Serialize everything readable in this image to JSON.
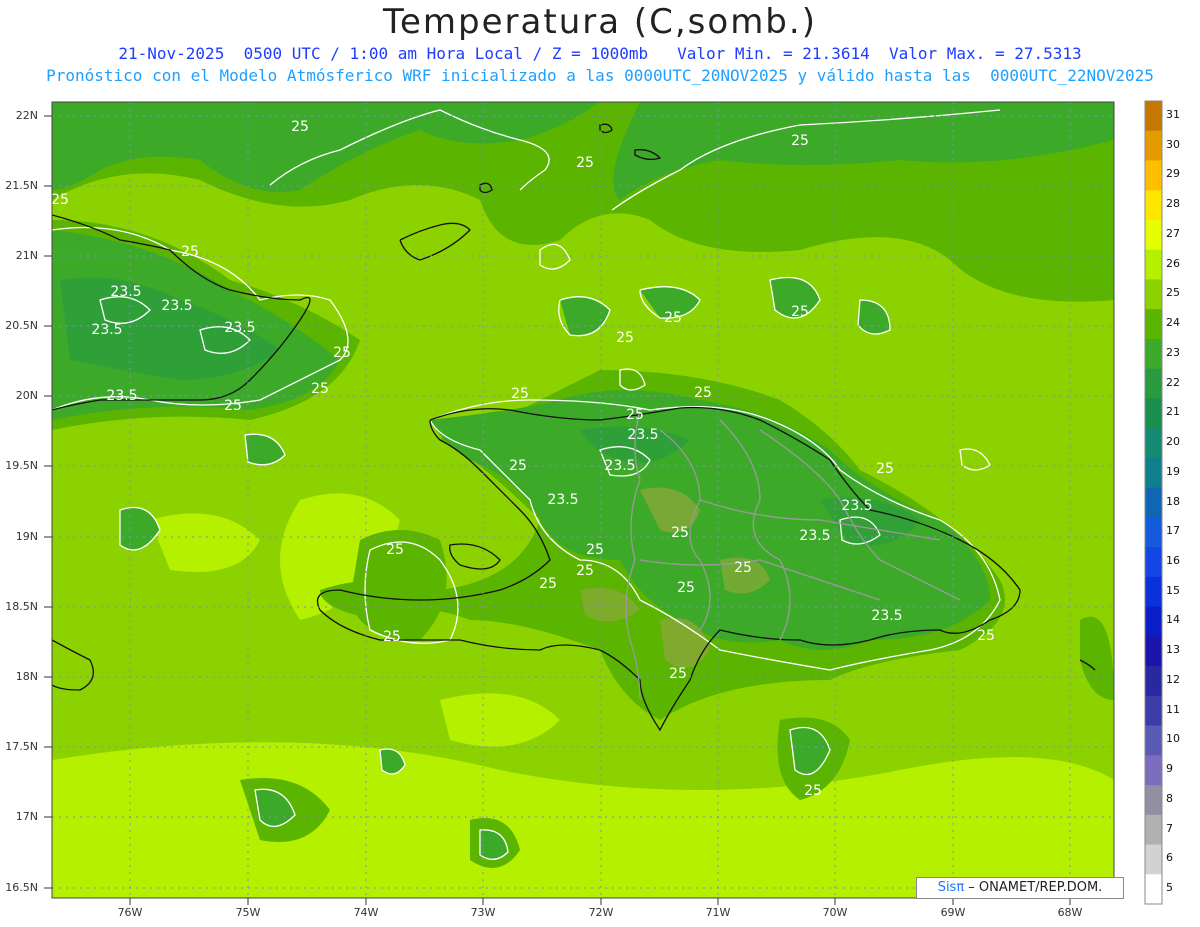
{
  "header": {
    "title": "Temperatura (C,somb.)",
    "line1": "21-Nov-2025  0500 UTC / 1:00 am Hora Local / Z = 1000mb   Valor Min. = 21.3614  Valor Max. = 27.5313",
    "line2": "Pronóstico con el Modelo Atmósferico WRF inicializado a las 0000UTC_20NOV2025 y válido hasta las  0000UTC_22NOV2025"
  },
  "axes": {
    "lat_labels": [
      "22N",
      "21.5N",
      "21N",
      "20.5N",
      "20N",
      "19.5N",
      "19N",
      "18.5N",
      "18N",
      "17.5N",
      "17N",
      "16.5N"
    ],
    "lon_labels": [
      "76W",
      "75W",
      "74W",
      "73W",
      "72W",
      "71W",
      "70W",
      "69W",
      "68W"
    ]
  },
  "colorbar": {
    "labels": [
      "31",
      "30",
      "29",
      "28",
      "27",
      "26",
      "25",
      "24",
      "23",
      "22",
      "21",
      "20",
      "19",
      "18",
      "17",
      "16",
      "15",
      "14",
      "13",
      "12",
      "11",
      "10",
      "9",
      "8",
      "7",
      "6",
      "5"
    ],
    "colors": [
      "#c47800",
      "#e39b00",
      "#ffbe00",
      "#ffe600",
      "#e6ff00",
      "#b4f000",
      "#8cd200",
      "#5ab400",
      "#3caa28",
      "#2a9a3e",
      "#1a8e4e",
      "#168a70",
      "#0f7f8c",
      "#1066b4",
      "#145adc",
      "#1446e6",
      "#0a32dc",
      "#0a1ec8",
      "#1a14aa",
      "#2828a0",
      "#3c3ca8",
      "#5a5ab4",
      "#7c6cbe",
      "#9090a0",
      "#b0b0b0",
      "#d2d2d2",
      "#ffffff"
    ]
  },
  "contour_labels": [
    "25",
    "23.5"
  ],
  "credit": {
    "sis": "Sisπ",
    "rest": " – ONAMET/REP.DOM."
  }
}
